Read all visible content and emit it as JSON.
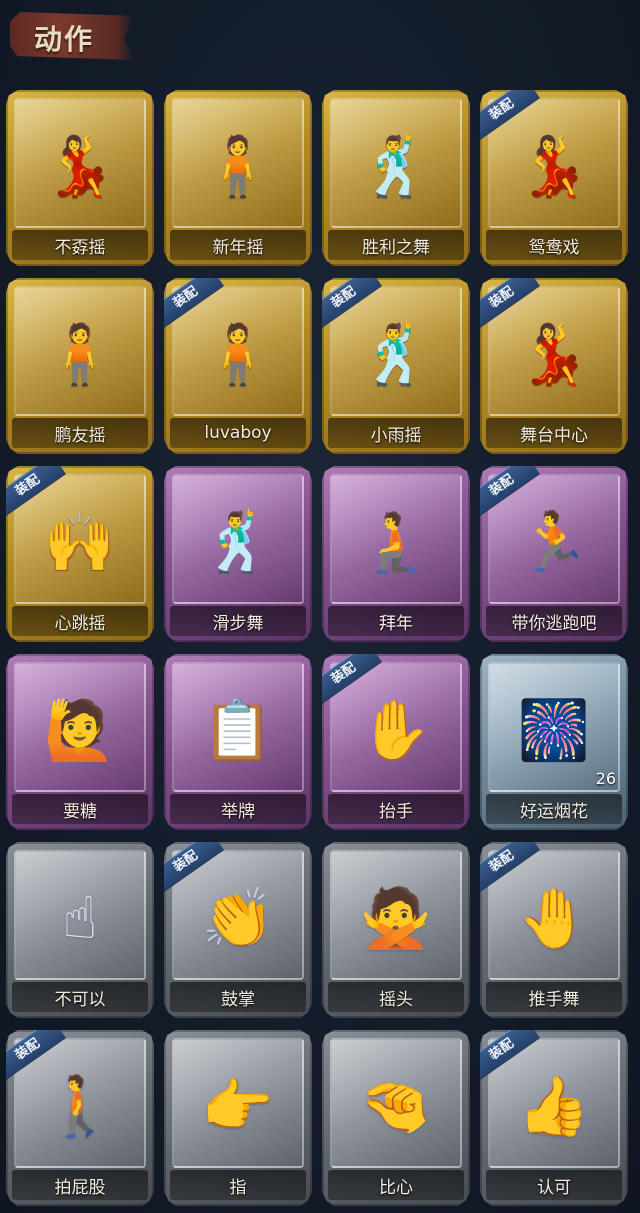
{
  "header": {
    "title": "动作"
  },
  "equipped_badge": "装配",
  "cards": [
    {
      "label": "不孬摇",
      "rarity": "gold",
      "equipped": false,
      "icon": "dancer-raised-arm-icon"
    },
    {
      "label": "新年摇",
      "rarity": "gold",
      "equipped": false,
      "icon": "dancer-crossed-arms-icon"
    },
    {
      "label": "胜利之舞",
      "rarity": "gold",
      "equipped": false,
      "icon": "victory-dance-icon"
    },
    {
      "label": "鸳鸯戏",
      "rarity": "gold",
      "equipped": true,
      "icon": "dancer-music-icon"
    },
    {
      "label": "鹏友摇",
      "rarity": "gold",
      "equipped": false,
      "icon": "dancer-arms-out-icon"
    },
    {
      "label": "luvaboy",
      "rarity": "gold",
      "equipped": true,
      "icon": "dancer-cross-icon"
    },
    {
      "label": "小雨摇",
      "rarity": "gold",
      "equipped": true,
      "icon": "dancer-point-icon"
    },
    {
      "label": "舞台中心",
      "rarity": "gold",
      "equipped": true,
      "icon": "dancer-spotlight-icon"
    },
    {
      "label": "心跳摇",
      "rarity": "gold",
      "equipped": true,
      "icon": "dancer-heartbeat-icon"
    },
    {
      "label": "滑步舞",
      "rarity": "purple",
      "equipped": false,
      "icon": "dancer-slide-icon"
    },
    {
      "label": "拜年",
      "rarity": "purple",
      "equipped": false,
      "icon": "greeting-bow-icon"
    },
    {
      "label": "带你逃跑吧",
      "rarity": "purple",
      "equipped": true,
      "icon": "dancer-run-icon"
    },
    {
      "label": "要糖",
      "rarity": "purple",
      "equipped": false,
      "icon": "ask-candy-icon"
    },
    {
      "label": "举牌",
      "rarity": "purple",
      "equipped": false,
      "icon": "hold-sign-icon"
    },
    {
      "label": "抬手",
      "rarity": "purple",
      "equipped": true,
      "icon": "raise-hand-icon"
    },
    {
      "label": "好运烟花",
      "rarity": "blue",
      "equipped": false,
      "icon": "firework-icon",
      "count": "26"
    },
    {
      "label": "不可以",
      "rarity": "grey",
      "equipped": false,
      "icon": "finger-wag-icon"
    },
    {
      "label": "鼓掌",
      "rarity": "grey",
      "equipped": true,
      "icon": "clap-icon"
    },
    {
      "label": "摇头",
      "rarity": "grey",
      "equipped": false,
      "icon": "shake-head-icon"
    },
    {
      "label": "推手舞",
      "rarity": "grey",
      "equipped": true,
      "icon": "push-hand-dance-icon"
    },
    {
      "label": "拍屁股",
      "rarity": "grey",
      "equipped": true,
      "icon": "butt-slap-icon"
    },
    {
      "label": "指",
      "rarity": "grey",
      "equipped": false,
      "icon": "point-finger-icon"
    },
    {
      "label": "比心",
      "rarity": "grey",
      "equipped": false,
      "icon": "finger-heart-icon"
    },
    {
      "label": "认可",
      "rarity": "grey",
      "equipped": true,
      "icon": "thumbs-up-icon"
    }
  ]
}
